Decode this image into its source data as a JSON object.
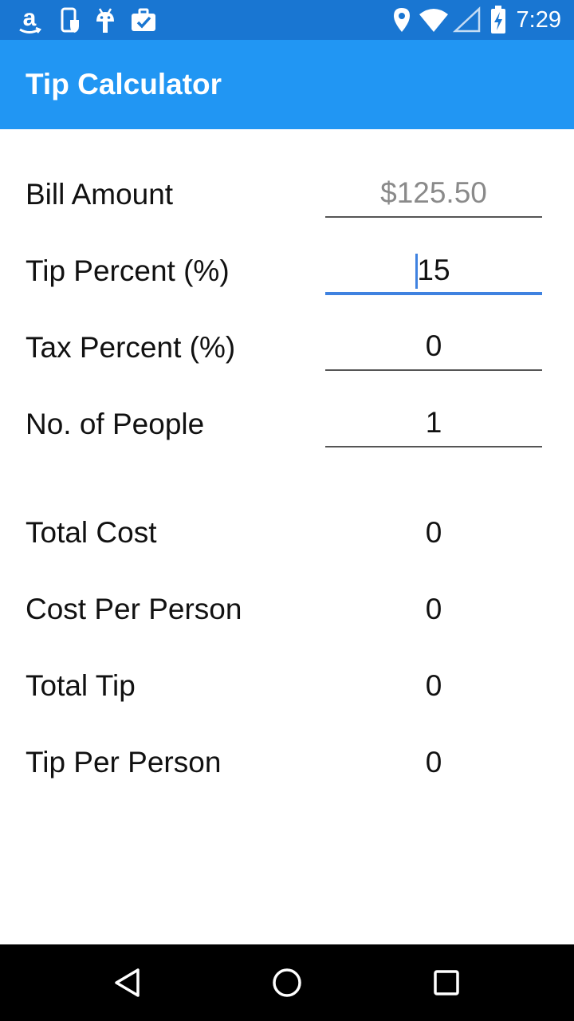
{
  "status_bar": {
    "time": "7:29",
    "left_icons": [
      "amazon-icon",
      "phone-shield-icon",
      "android-icon",
      "briefcase-check-icon"
    ],
    "right_icons": [
      "location-icon",
      "wifi-icon",
      "signal-icon",
      "battery-charging-icon"
    ]
  },
  "app_bar": {
    "title": "Tip Calculator",
    "color": "#2196F3",
    "status_color": "#1976D2"
  },
  "inputs": {
    "bill_amount": {
      "label": "Bill Amount",
      "value": "",
      "placeholder": "$125.50"
    },
    "tip_percent": {
      "label": "Tip Percent (%)",
      "value": "15",
      "focused": true
    },
    "tax_percent": {
      "label": "Tax Percent (%)",
      "value": "0"
    },
    "people": {
      "label": "No. of People",
      "value": "1"
    }
  },
  "results": {
    "total_cost": {
      "label": "Total Cost",
      "value": "0"
    },
    "cost_per_person": {
      "label": "Cost Per Person",
      "value": "0"
    },
    "total_tip": {
      "label": "Total Tip",
      "value": "0"
    },
    "tip_per_person": {
      "label": "Tip Per Person",
      "value": "0"
    }
  },
  "nav_bar": {
    "buttons": [
      "back-icon",
      "home-icon",
      "recents-icon"
    ]
  }
}
